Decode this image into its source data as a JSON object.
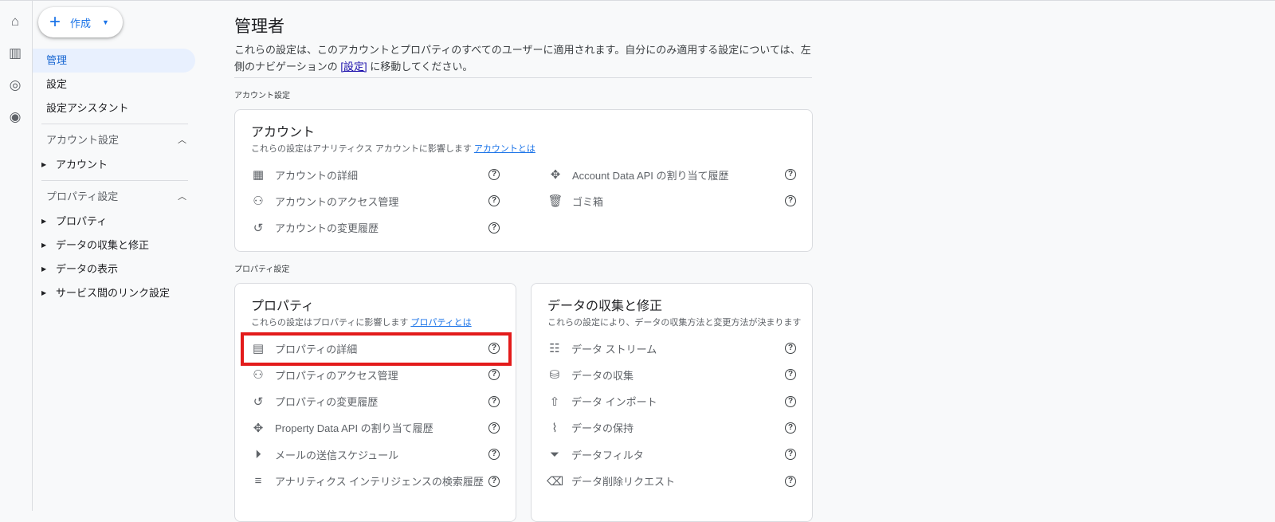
{
  "create_button": {
    "label": "作成"
  },
  "nav": {
    "items": [
      "管理",
      "設定",
      "設定アシスタント"
    ],
    "account_section": "アカウント設定",
    "account_items": [
      "アカウント"
    ],
    "property_section": "プロパティ設定",
    "property_items": [
      "プロパティ",
      "データの収集と修正",
      "データの表示",
      "サービス間のリンク設定"
    ]
  },
  "page": {
    "title": "管理者",
    "desc_before": "これらの設定は、このアカウントとプロパティのすべてのユーザーに適用されます。自分にのみ適用する設定については、左側のナビゲーションの ",
    "desc_link": "[設定]",
    "desc_after": " に移動してください。",
    "account_label": "アカウント設定",
    "property_label": "プロパティ設定"
  },
  "account_card": {
    "title": "アカウント",
    "subtitle": "これらの設定はアナリティクス アカウントに影響します",
    "link": "アカウントとは",
    "left": [
      {
        "icon": "building-icon",
        "label": "アカウントの詳細"
      },
      {
        "icon": "people-icon",
        "label": "アカウントのアクセス管理"
      },
      {
        "icon": "history-icon",
        "label": "アカウントの変更履歴"
      }
    ],
    "right": [
      {
        "icon": "api-icon",
        "label": "Account Data API の割り当て履歴"
      },
      {
        "icon": "trash-icon",
        "label": "ゴミ箱"
      }
    ]
  },
  "property_card": {
    "title": "プロパティ",
    "subtitle": "これらの設定はプロパティに影響します",
    "link": "プロパティとは",
    "items": [
      {
        "icon": "property-details-icon",
        "label": "プロパティの詳細"
      },
      {
        "icon": "people-icon",
        "label": "プロパティのアクセス管理"
      },
      {
        "icon": "history-icon",
        "label": "プロパティの変更履歴"
      },
      {
        "icon": "api-icon",
        "label": "Property Data API の割り当て履歴"
      },
      {
        "icon": "scheduled-email-icon",
        "label": "メールの送信スケジュール"
      },
      {
        "icon": "search-history-icon",
        "label": "アナリティクス インテリジェンスの検索履歴"
      }
    ]
  },
  "data_card": {
    "title": "データの収集と修正",
    "subtitle": "これらの設定により、データの収集方法と変更方法が決まります",
    "items": [
      {
        "icon": "data-stream-icon",
        "label": "データ ストリーム"
      },
      {
        "icon": "database-icon",
        "label": "データの収集"
      },
      {
        "icon": "upload-icon",
        "label": "データ インポート"
      },
      {
        "icon": "attachment-icon",
        "label": "データの保持"
      },
      {
        "icon": "filter-icon",
        "label": "データフィルタ"
      },
      {
        "icon": "eraser-icon",
        "label": "データ削除リクエスト"
      }
    ]
  },
  "help_glyph": "?"
}
